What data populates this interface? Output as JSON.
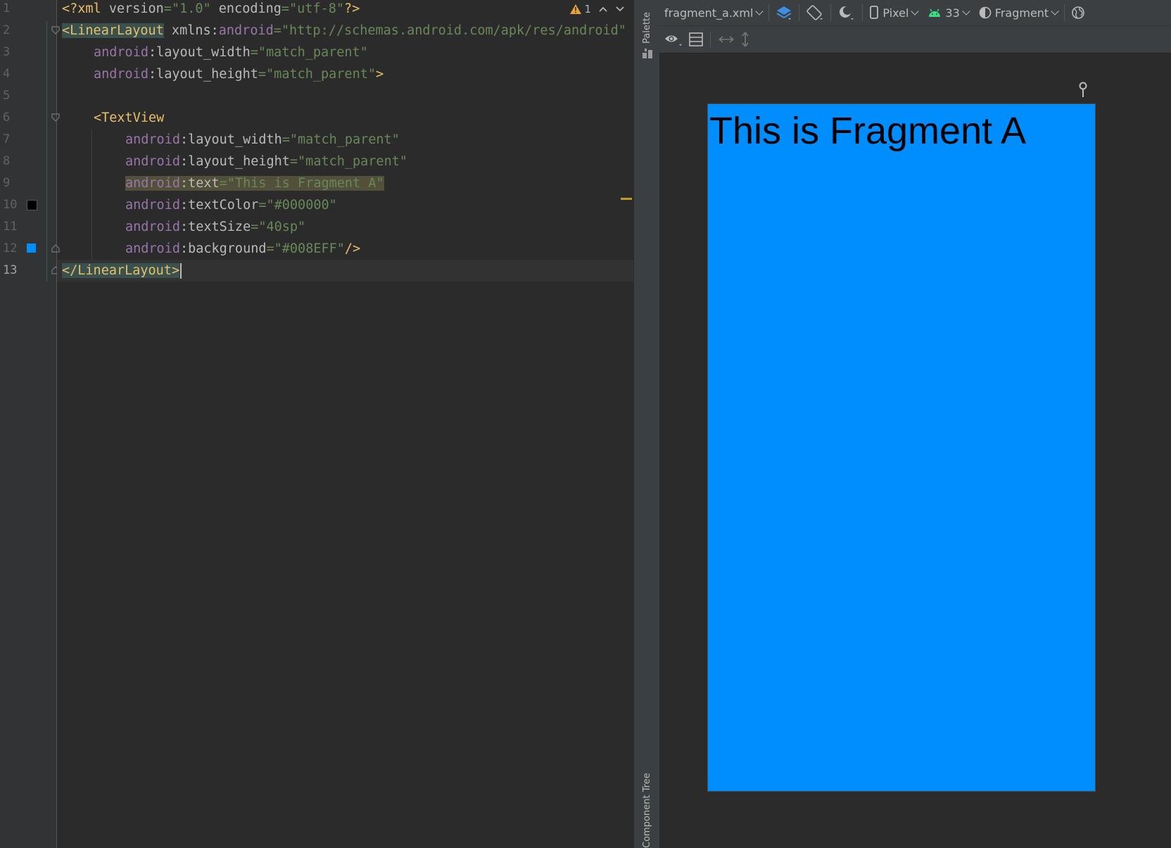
{
  "editor": {
    "line_numbers": [
      "1",
      "2",
      "3",
      "4",
      "5",
      "6",
      "7",
      "8",
      "9",
      "10",
      "11",
      "12",
      "13"
    ],
    "lines": {
      "l1": {
        "a": "<?xml ",
        "b": "version",
        "c": "=",
        "d": "\"1.0\"",
        "e": " encoding",
        "f": "=",
        "g": "\"utf-8\"",
        "h": "?>"
      },
      "l2": {
        "a": "<LinearLayout",
        "b": " xmlns:",
        "c": "android",
        "d": "=",
        "e": "\"http://schemas.android.com/apk/res/android\""
      },
      "l3": {
        "ns": "android",
        "attr": ":layout_width",
        "eq": "=",
        "val": "\"match_parent\""
      },
      "l4": {
        "ns": "android",
        "attr": ":layout_height",
        "eq": "=",
        "val": "\"match_parent\"",
        "end": ">"
      },
      "l6": {
        "tag": "<TextView"
      },
      "l7": {
        "ns": "android",
        "attr": ":layout_width",
        "eq": "=",
        "val": "\"match_parent\""
      },
      "l8": {
        "ns": "android",
        "attr": ":layout_height",
        "eq": "=",
        "val": "\"match_parent\""
      },
      "l9": {
        "ns": "android",
        "attr": ":text",
        "eq": "=",
        "val": "\"This is Fragment A\""
      },
      "l10": {
        "ns": "android",
        "attr": ":textColor",
        "eq": "=",
        "val": "\"#000000\""
      },
      "l11": {
        "ns": "android",
        "attr": ":textSize",
        "eq": "=",
        "val": "\"40sp\""
      },
      "l12": {
        "ns": "android",
        "attr": ":background",
        "eq": "=",
        "val": "\"#008EFF\"",
        "end": "/>"
      },
      "l13": {
        "tag": "</LinearLayout",
        "end": ">"
      }
    },
    "swatch_colors": {
      "line10": "#000000",
      "line12": "#008EFF"
    },
    "inspection": {
      "warning_count": "1",
      "icon": "warning-triangle-icon"
    }
  },
  "side_panel": {
    "palette_label": "Palette",
    "component_tree_label": "Component Tree"
  },
  "design_toolbar": {
    "file_name": "fragment_a.xml",
    "device": "Pixel",
    "api_level": "33",
    "theme": "Fragment",
    "icons": [
      "layers-icon",
      "orientation-icon",
      "night-mode-icon",
      "device-icon",
      "android-icon",
      "theme-icon",
      "globe-icon"
    ]
  },
  "design_toolbar2": {
    "icons": [
      "eye-icon",
      "blueprint-icon",
      "horizontal-resize-icon",
      "vertical-resize-icon"
    ]
  },
  "preview": {
    "text": "This is Fragment A",
    "background": "#008EFF",
    "text_color": "#000000"
  },
  "colors": {
    "editor_bg": "#2b2b2b",
    "gutter_bg": "#313335",
    "tag": "#e8bf6a",
    "attr_ns": "#9876aa",
    "string": "#6a8759"
  }
}
